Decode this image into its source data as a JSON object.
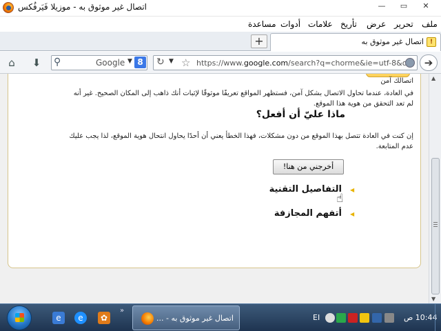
{
  "window": {
    "title": "اتصال غير موثوق به - موزيلا فَيَرفُكس",
    "controls": [
      "—",
      "▭",
      "✕"
    ]
  },
  "menu": {
    "items": [
      "ملف",
      "تحرير",
      "عرض",
      "تأريخ",
      "علامات",
      "أدوات",
      "مساعدة"
    ]
  },
  "tabs": {
    "new_tab": "+",
    "active_tab_title": "اتصال غير موثوق به"
  },
  "navbar": {
    "search_engine": "Google",
    "search_badge": "8",
    "url_prefix": "https://www.",
    "url_domain": "google.com",
    "url_rest": "/search?q=chorme&ie=utf-8&o"
  },
  "page": {
    "partial_line": "اتصالك آمن",
    "normal_paragraph": "في العادة، عندما تحاول الاتصال بشكل آمن، فستظهر المواقع تعريفًا موثوقًا لإثبات أنك ذاهب إلى المكان الصحيح. غير أنه لم تعد التحقق من هوية هذا الموقع.",
    "what_heading": "ماذا عليّ أن أفعل؟",
    "advice_paragraph": "إن كنت في العادة تتصل بهذا الموقع من دون مشكلات، فهذا الخطأ يعني أن أحدًا يحاول انتحال هوية الموقع، لذا يجب عليك عدم المتابعة.",
    "get_me_out_button": "أخرجني من هنا!",
    "technical_details": "التفاصيل التقنية",
    "understand_risks": "أتفهم المجازفة"
  },
  "taskbar": {
    "task_title": "اتصال غير موثوق به - ...",
    "chevron": "»",
    "language": "EI",
    "clock": "10:44 ص"
  },
  "colors": {
    "accent_yellow": "#ffd35e",
    "card_border": "#d6c48a",
    "taskbar": "#1e3450"
  }
}
